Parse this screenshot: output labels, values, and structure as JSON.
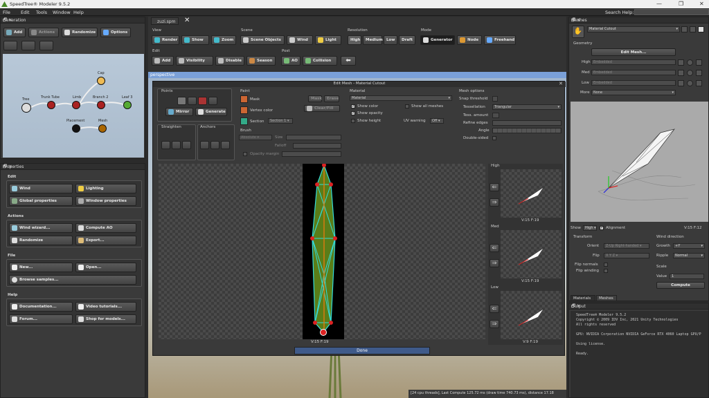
{
  "app": {
    "title": "SpeedTree® Modeler 9.5.2"
  },
  "menu": {
    "items": [
      "File",
      "Edit",
      "Tools",
      "Window",
      "Help"
    ],
    "search_label": "Search Help:"
  },
  "generation": {
    "title": "Generation",
    "toolbar": {
      "add": "Add",
      "actions": "Actions",
      "randomize": "Randomize",
      "options": "Options"
    },
    "nodes": {
      "tree": "Tree",
      "trunk": "Trunk",
      "tube": "Tube",
      "limb": "Limb",
      "branch": "Branch 2",
      "leaf": "Leaf 3",
      "cap": "Cap",
      "placement": "Placement",
      "mesh": "Mesh"
    }
  },
  "properties": {
    "title": "Properties",
    "edit": {
      "heading": "Edit",
      "wind": "Wind",
      "lighting": "Lighting",
      "global": "Global properties",
      "window": "Window properties"
    },
    "actions": {
      "heading": "Actions",
      "wind_wizard": "Wind wizard...",
      "compute_ao": "Compute AO",
      "randomize": "Randomize",
      "export": "Export..."
    },
    "file": {
      "heading": "File",
      "new": "New...",
      "open": "Open...",
      "browse": "Browse samples..."
    },
    "help": {
      "heading": "Help",
      "documentation": "Documentation...",
      "video": "Video tutorials...",
      "forum": "Forum...",
      "shop": "Shop for models..."
    }
  },
  "doc": {
    "tab": "zuzi.spm",
    "viewport": "perspective",
    "status": "[24 cpu threads], Last Compute 125.72 ms (draw time 740.73 ms), distance 17.18"
  },
  "view_toolbar": {
    "view": {
      "heading": "View",
      "render": "Render",
      "show": "Show",
      "zoom": "Zoom"
    },
    "scene": {
      "heading": "Scene",
      "objects": "Scene Objects",
      "wind": "Wind",
      "light": "Light"
    },
    "resolution": {
      "heading": "Resolution",
      "high": "High",
      "medium": "Medium",
      "low": "Low",
      "draft": "Draft"
    },
    "mode": {
      "heading": "Mode",
      "generator": "Generator",
      "node": "Node",
      "freehand": "Freehand"
    },
    "edit": {
      "heading": "Edit",
      "add": "Add",
      "visibility": "Visibility",
      "disable": "Disable",
      "season": "Season"
    },
    "post": {
      "heading": "Post",
      "ao": "AO",
      "collision": "Collision"
    }
  },
  "edit_mesh": {
    "title": "Edit Mesh - Material Cutout",
    "points": {
      "heading": "Points",
      "mirror": "Mirror",
      "generate": "Generate"
    },
    "straighten": "Straighten",
    "anchors": "Anchors",
    "paint": {
      "heading": "Paint",
      "mask": "Mask",
      "vertex_color": "Vertex color",
      "section": "Section",
      "section_value": "Section 1",
      "mask_btn": "Mask",
      "erase_btn": "Erase",
      "clear_fill": "Clear/Fill"
    },
    "brush": {
      "heading": "Brush",
      "mode": "Absolute",
      "size": "Size",
      "falloff": "Falloff",
      "opacity": "Opacity",
      "margin": "margin"
    },
    "material": {
      "heading": "Material",
      "value": "Material",
      "show_color": "Show color",
      "show_all": "Show all meshes",
      "show_opacity": "Show opacity",
      "show_height": "Show height",
      "uv_warning": "UV warning",
      "uv_value": "Off"
    },
    "mesh_options": {
      "heading": "Mesh options",
      "snap": "Snap threshold",
      "tessellation": "Tessellation",
      "tess_value": "Triangular",
      "tess_amount": "Tess. amount",
      "refine": "Refine edges",
      "angle": "Angle",
      "double_sided": "Double-sided"
    },
    "main_stats": "V:15  F:19",
    "lods": [
      {
        "label": "High",
        "stats": "V:15  F:19"
      },
      {
        "label": "Med",
        "stats": "V:15  F:19"
      },
      {
        "label": "Low",
        "stats": "V:9  F:19"
      }
    ],
    "done": "Done"
  },
  "meshes": {
    "title": "Meshes",
    "selected": "Material Cutout",
    "geometry": {
      "heading": "Geometry",
      "edit_mesh": "Edit Mesh...",
      "high": "High",
      "med": "Med",
      "low": "Low",
      "embedded": "Embedded",
      "more": "More",
      "more_value": "None"
    },
    "show": {
      "label": "Show",
      "value": "High",
      "alignment": "Alignment",
      "stats": "V:15  F:12"
    },
    "transform": {
      "heading": "Transform",
      "orient": "Orient",
      "orient_value": "Z-Up Right-handed",
      "flip": "Flip",
      "flip_value": "X Y Z",
      "flip_normals": "Flip normals",
      "flip_winding": "Flip winding"
    },
    "wind_direction": {
      "heading": "Wind direction",
      "growth": "Growth",
      "growth_value": "+Y",
      "ripple": "Ripple",
      "ripple_value": "Normal"
    },
    "scale": {
      "heading": "Scale",
      "value_label": "Value",
      "value": "1",
      "compute": "Compute"
    },
    "tabs": [
      "Materials",
      "Meshes"
    ]
  },
  "output": {
    "title": "Output",
    "lines": [
      "SpeedTree® Modeler 9.5.2",
      "Copyright © 2009 IDV Inc, 2021 Unity Technologies",
      "All rights reserved",
      "",
      "GPU: NVIDIA Corporation NVIDIA GeForce RTX 4060 Laptop GPU/P",
      "",
      "Using license.",
      "",
      "Ready."
    ]
  },
  "colors": {
    "accent": "#7aa0d8",
    "leaf_fill": "#5a7d18",
    "wire": "#33dddd",
    "vertex": "#dd2222"
  }
}
